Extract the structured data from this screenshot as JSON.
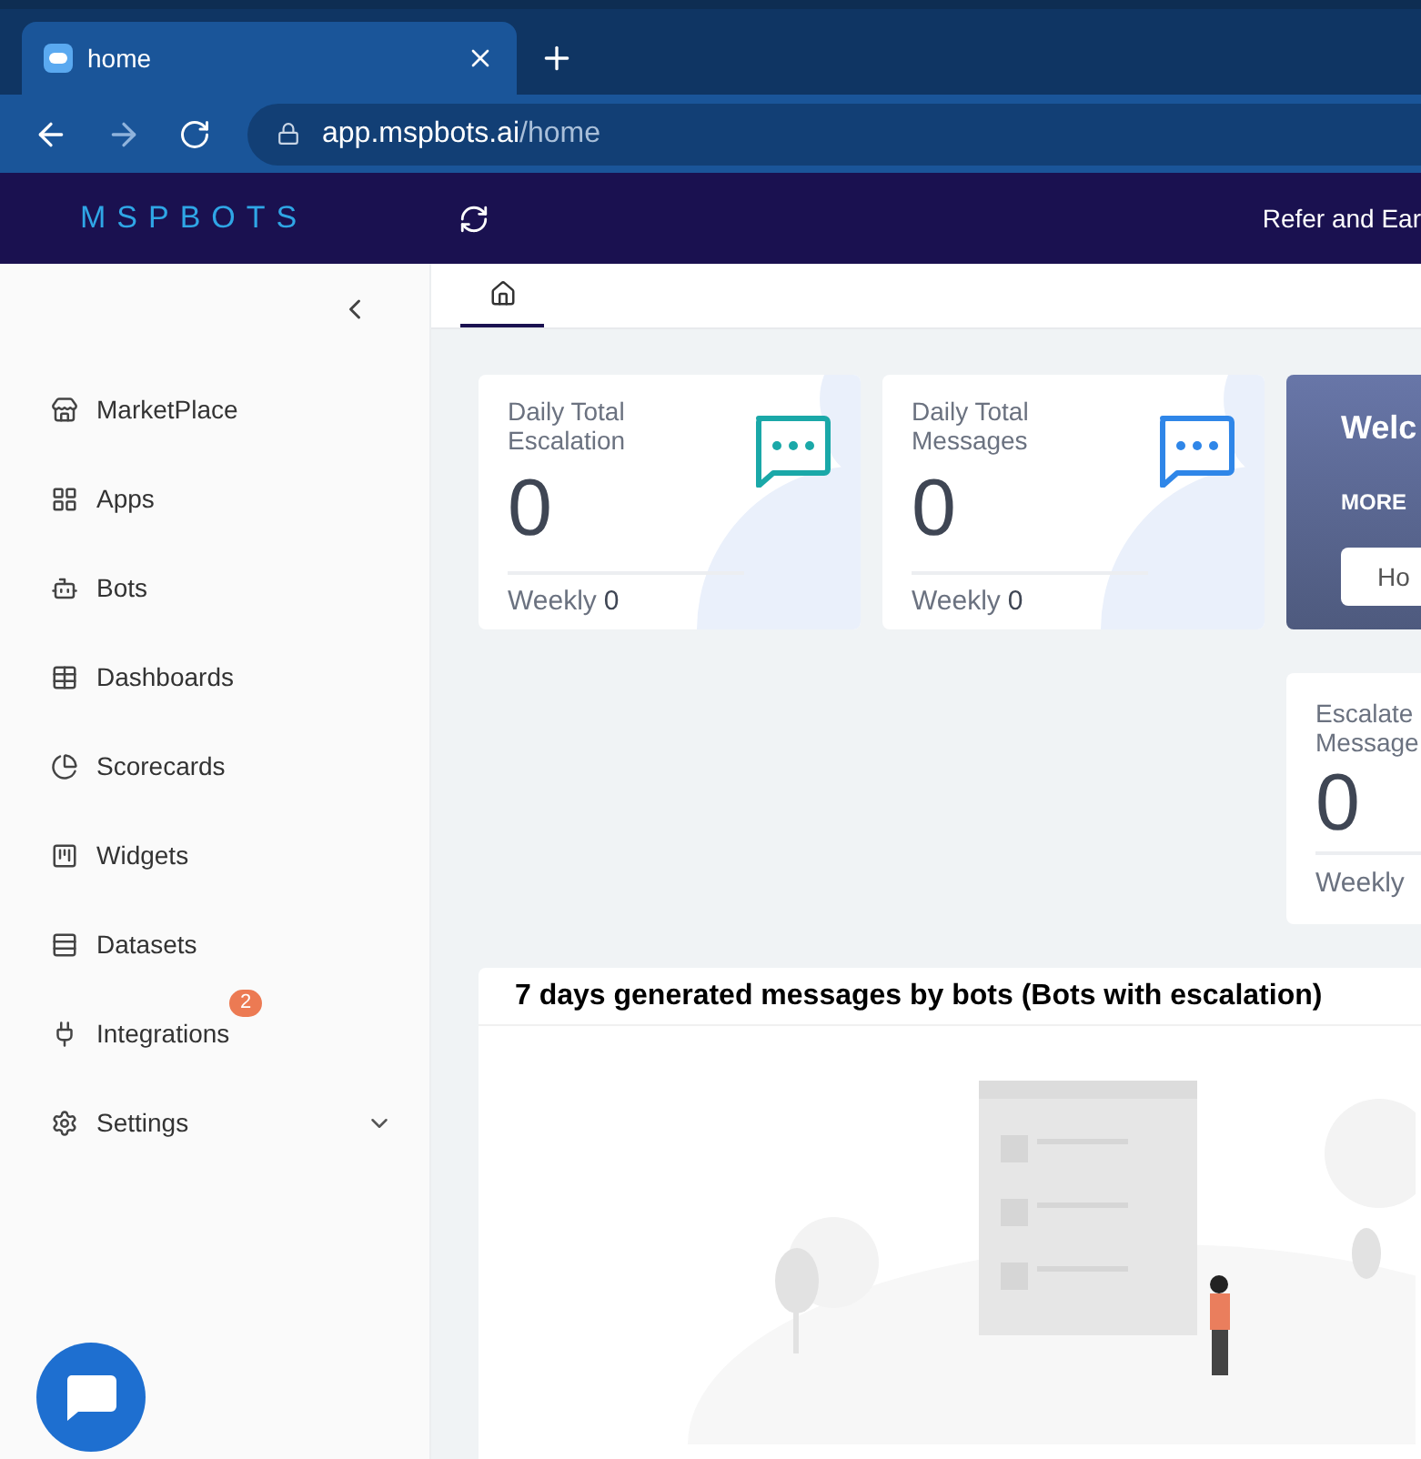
{
  "browser": {
    "tabs": [
      {
        "title": "home",
        "selected": true
      }
    ],
    "url_host": "app.mspbots.ai",
    "url_path": "/home"
  },
  "header": {
    "logo": "MSPBOTS",
    "refer": "Refer and Ear"
  },
  "sidebar": {
    "items": [
      {
        "label": "MarketPlace"
      },
      {
        "label": "Apps"
      },
      {
        "label": "Bots"
      },
      {
        "label": "Dashboards"
      },
      {
        "label": "Scorecards"
      },
      {
        "label": "Widgets"
      },
      {
        "label": "Datasets"
      },
      {
        "label": "Integrations",
        "badge": "2"
      },
      {
        "label": "Settings",
        "expandable": true
      }
    ]
  },
  "page_tabs": [
    {
      "kind": "home",
      "selected": true
    }
  ],
  "stats": [
    {
      "title": "Daily Total Escalation",
      "value": "0",
      "weekly_label": "Weekly",
      "weekly_value": "0",
      "color": "#1aa8a8"
    },
    {
      "title": "Daily Total Messages",
      "value": "0",
      "weekly_label": "Weekly",
      "weekly_value": "0",
      "color": "#2f86e8"
    }
  ],
  "welcome": {
    "title": "Welc",
    "subtitle": "MORE",
    "button": "Ho"
  },
  "escalated": {
    "title": "Escalate Message",
    "value": "0",
    "weekly_label": "Weekly"
  },
  "chart_card": {
    "title": "7 days generated messages by bots (Bots with escalation)"
  }
}
